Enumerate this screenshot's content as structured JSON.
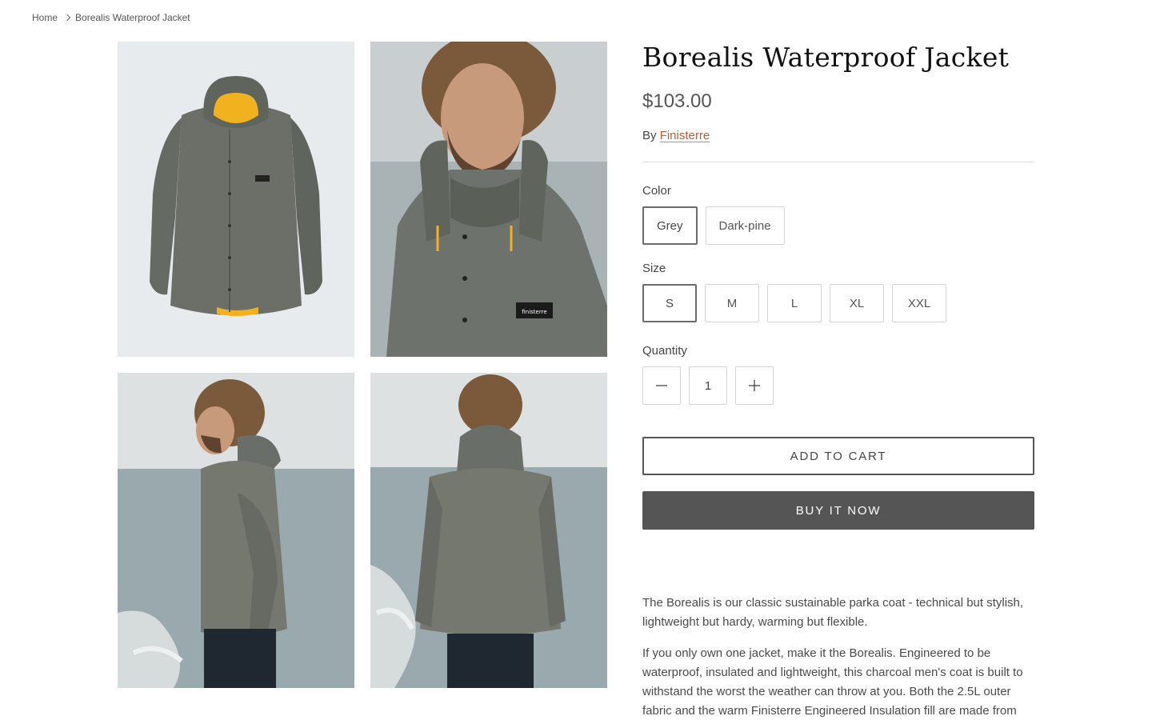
{
  "breadcrumb": {
    "home": "Home",
    "current": "Borealis Waterproof Jacket"
  },
  "product": {
    "title": "Borealis Waterproof Jacket",
    "price": "$103.00",
    "vendor_prefix": "By",
    "vendor": "Finisterre"
  },
  "options": {
    "color": {
      "label": "Color",
      "values": [
        "Grey",
        "Dark-pine"
      ],
      "selected": "Grey"
    },
    "size": {
      "label": "Size",
      "values": [
        "S",
        "M",
        "L",
        "XL",
        "XXL"
      ],
      "selected": "S"
    }
  },
  "quantity": {
    "label": "Quantity",
    "value": "1",
    "decrease_icon": "minus-icon",
    "increase_icon": "plus-icon"
  },
  "actions": {
    "add_to_cart": "ADD TO CART",
    "buy_now": "BUY IT NOW"
  },
  "description": {
    "p1": "The Borealis is our classic sustainable parka coat - technical but stylish, lightweight but hardy, warming but flexible.",
    "p2": "If you only own one jacket, make it the Borealis. Engineered to be waterproof, insulated and lightweight, this charcoal men's coat is built to withstand the worst the weather can throw at you. Both the 2.5L outer fabric and the warm Finisterre Engineered Insulation fill are made from"
  },
  "gallery": {
    "images": [
      "product-front-image",
      "model-closeup-image",
      "model-side-image",
      "model-back-image"
    ],
    "jacket_label": "finisterre"
  },
  "colors": {
    "jacket": "#6b6f68",
    "lining": "#f2b11e",
    "sea": "#9fb0b4",
    "sky": "#dfe3e4",
    "buy_button": "#555555",
    "vendor_link": "#b85c38"
  }
}
